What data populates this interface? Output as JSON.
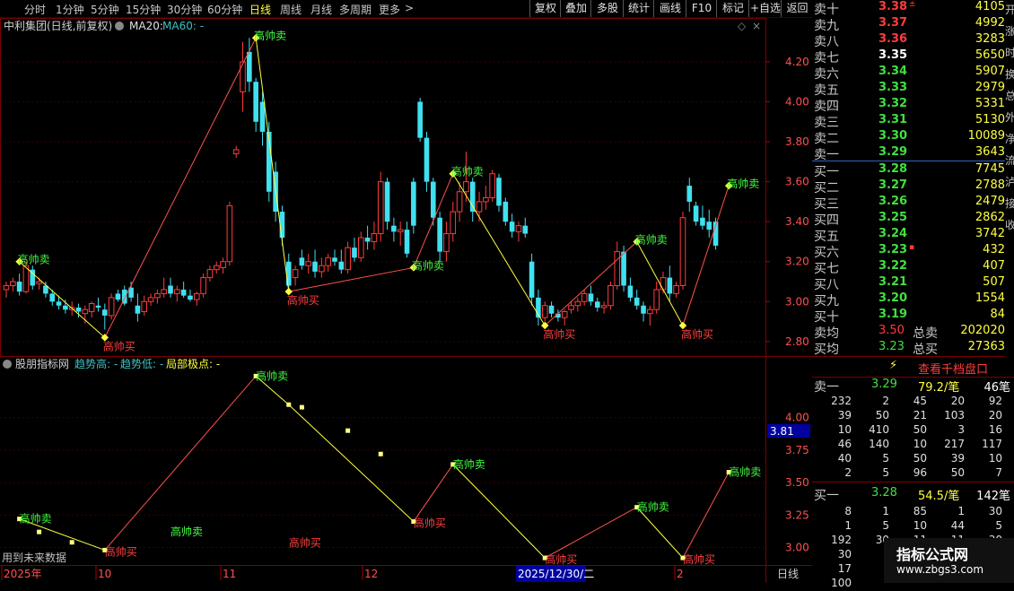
{
  "toolbar": {
    "periods": [
      "分时",
      "1分钟",
      "5分钟",
      "15分钟",
      "30分钟",
      "60分钟",
      "日线",
      "周线",
      "月线",
      "多周期",
      "更多"
    ],
    "active_period": "日线",
    "more_arrow": ">",
    "buttons": [
      "复权",
      "叠加",
      "多股",
      "统计",
      "画线",
      "F10",
      "标记",
      "+自选",
      "返回"
    ]
  },
  "main_panel": {
    "title": "中利集团(日线,前复权)",
    "ma20_label": "MA20:",
    "ma60_label": "MA60: -",
    "y_ticks": [
      "4.20",
      "4.00",
      "3.80",
      "3.60",
      "3.40",
      "3.20",
      "3.00",
      "2.80"
    ]
  },
  "indicator_panel": {
    "title": "股朋指标网",
    "trend_high": "趋势高: -",
    "trend_low": "趋势低: -",
    "local_extreme": "局部极点: -",
    "y_ticks": [
      "4.00",
      "3.75",
      "3.50",
      "3.25",
      "3.00"
    ],
    "current_value": "3.81",
    "future_data_note": "用到未来数据"
  },
  "x_axis": {
    "labels": [
      "2025年",
      "10",
      "11",
      "12",
      "1",
      "2"
    ],
    "cursor_date": "2025/12/30/二",
    "period_label": "日线"
  },
  "signals": {
    "sell": "高帅卖",
    "buy": "高帅买"
  },
  "orderbook": {
    "asks": [
      {
        "label": "卖十",
        "price": "3.38",
        "vol": "4105",
        "color": "#ff3c3c",
        "mark": "±"
      },
      {
        "label": "卖九",
        "price": "3.37",
        "vol": "4992",
        "color": "#ff3c3c",
        "mark": ""
      },
      {
        "label": "卖八",
        "price": "3.36",
        "vol": "3283",
        "color": "#ff3c3c",
        "mark": ""
      },
      {
        "label": "卖七",
        "price": "3.35",
        "vol": "5650",
        "color": "#ffffff",
        "mark": ""
      },
      {
        "label": "卖六",
        "price": "3.34",
        "vol": "5907",
        "color": "#40e040",
        "mark": ""
      },
      {
        "label": "卖五",
        "price": "3.33",
        "vol": "2979",
        "color": "#40e040",
        "mark": ""
      },
      {
        "label": "卖四",
        "price": "3.32",
        "vol": "5331",
        "color": "#40e040",
        "mark": ""
      },
      {
        "label": "卖三",
        "price": "3.31",
        "vol": "5130",
        "color": "#40e040",
        "mark": ""
      },
      {
        "label": "卖二",
        "price": "3.30",
        "vol": "10089",
        "color": "#40e040",
        "mark": ""
      },
      {
        "label": "卖一",
        "price": "3.29",
        "vol": "3643",
        "color": "#40e040",
        "mark": ""
      }
    ],
    "bids": [
      {
        "label": "买一",
        "price": "3.28",
        "vol": "7745",
        "color": "#40e040",
        "mark": ""
      },
      {
        "label": "买二",
        "price": "3.27",
        "vol": "2788",
        "color": "#40e040",
        "mark": ""
      },
      {
        "label": "买三",
        "price": "3.26",
        "vol": "2479",
        "color": "#40e040",
        "mark": ""
      },
      {
        "label": "买四",
        "price": "3.25",
        "vol": "2862",
        "color": "#40e040",
        "mark": ""
      },
      {
        "label": "买五",
        "price": "3.24",
        "vol": "3742",
        "color": "#40e040",
        "mark": ""
      },
      {
        "label": "买六",
        "price": "3.23",
        "vol": "432",
        "color": "#40e040",
        "mark": "▪"
      },
      {
        "label": "买七",
        "price": "3.22",
        "vol": "407",
        "color": "#40e040",
        "mark": ""
      },
      {
        "label": "买八",
        "price": "3.21",
        "vol": "507",
        "color": "#40e040",
        "mark": ""
      },
      {
        "label": "买九",
        "price": "3.20",
        "vol": "1554",
        "color": "#40e040",
        "mark": ""
      },
      {
        "label": "买十",
        "price": "3.19",
        "vol": "84",
        "color": "#40e040",
        "mark": ""
      }
    ],
    "avg_sell": {
      "label": "卖均",
      "price": "3.50",
      "total_label": "总卖",
      "total": "202020"
    },
    "avg_buy": {
      "label": "买均",
      "price": "3.23",
      "total_label": "总买",
      "total": "27363"
    },
    "qiandang_button": "查看千档盘口",
    "sell1_summary": {
      "label": "卖一",
      "price": "3.29",
      "per": "79.2/笔",
      "count": "46笔"
    },
    "sell1_orders": [
      [
        "232",
        "2",
        "45",
        "20",
        "92"
      ],
      [
        "39",
        "50",
        "21",
        "103",
        "20"
      ],
      [
        "10",
        "410",
        "50",
        "3",
        "16"
      ],
      [
        "46",
        "140",
        "10",
        "217",
        "117"
      ],
      [
        "40",
        "5",
        "50",
        "39",
        "10"
      ],
      [
        "2",
        "5",
        "96",
        "50",
        "7"
      ]
    ],
    "buy1_summary": {
      "label": "买一",
      "price": "3.28",
      "per": "54.5/笔",
      "count": "142笔"
    },
    "buy1_orders": [
      [
        "8",
        "1",
        "85",
        "1",
        "30"
      ],
      [
        "1",
        "5",
        "10",
        "44",
        "5"
      ],
      [
        "192",
        "30",
        "11",
        "11",
        "30"
      ],
      [
        "30",
        "",
        "",
        "",
        ""
      ],
      [
        "17",
        "",
        "",
        "",
        ""
      ],
      [
        "100",
        "",
        "",
        "",
        ""
      ]
    ]
  },
  "side_strip": [
    "开",
    "涨",
    "时",
    "换",
    "总",
    "外",
    "净",
    "流",
    "泸",
    "接",
    "收"
  ],
  "watermark": {
    "title": "指标公式网",
    "url": "www.zbgs3.com"
  },
  "chart_data": {
    "type": "candlestick",
    "ylim": [
      2.75,
      4.33
    ],
    "candles": [
      [
        3.06,
        3.1,
        3.02,
        3.08
      ],
      [
        3.08,
        3.12,
        3.05,
        3.1
      ],
      [
        3.1,
        3.14,
        3.03,
        3.05
      ],
      [
        3.05,
        3.2,
        3.04,
        3.18
      ],
      [
        3.16,
        3.18,
        3.06,
        3.08
      ],
      [
        3.09,
        3.12,
        3.06,
        3.1
      ],
      [
        3.08,
        3.1,
        3.02,
        3.04
      ],
      [
        3.04,
        3.06,
        2.98,
        3.0
      ],
      [
        3.0,
        3.03,
        2.96,
        2.98
      ],
      [
        2.98,
        3.01,
        2.94,
        2.96
      ],
      [
        2.96,
        3.0,
        2.93,
        2.97
      ],
      [
        2.97,
        2.99,
        2.92,
        2.95
      ],
      [
        2.94,
        2.98,
        2.89,
        2.96
      ],
      [
        2.95,
        3.0,
        2.92,
        2.99
      ],
      [
        2.98,
        3.02,
        2.95,
        2.97
      ],
      [
        2.96,
        2.99,
        2.86,
        2.93
      ],
      [
        2.93,
        3.04,
        2.91,
        3.02
      ],
      [
        3.04,
        3.06,
        3.0,
        3.01
      ],
      [
        3.06,
        3.08,
        2.98,
        2.99
      ],
      [
        3.07,
        3.1,
        3.0,
        3.02
      ],
      [
        2.98,
        3.04,
        2.9,
        2.94
      ],
      [
        2.95,
        3.03,
        2.93,
        3.0
      ],
      [
        3.0,
        3.04,
        2.98,
        3.02
      ],
      [
        3.02,
        3.06,
        2.99,
        3.04
      ],
      [
        3.04,
        3.12,
        3.02,
        3.06
      ],
      [
        3.08,
        3.12,
        3.02,
        3.04
      ],
      [
        3.04,
        3.08,
        3.0,
        3.06
      ],
      [
        3.06,
        3.1,
        3.02,
        3.03
      ],
      [
        3.03,
        3.06,
        3.0,
        3.01
      ],
      [
        3.01,
        3.05,
        2.98,
        3.04
      ],
      [
        3.04,
        3.14,
        3.02,
        3.12
      ],
      [
        3.12,
        3.18,
        3.1,
        3.16
      ],
      [
        3.16,
        3.2,
        3.14,
        3.18
      ],
      [
        3.17,
        3.22,
        3.14,
        3.2
      ],
      [
        3.2,
        3.5,
        3.18,
        3.48
      ],
      [
        3.74,
        3.78,
        3.72,
        3.76
      ],
      [
        4.05,
        4.3,
        3.95,
        4.2
      ],
      [
        4.25,
        4.32,
        4.05,
        4.1
      ],
      [
        4.1,
        4.12,
        3.85,
        3.9
      ],
      [
        4.0,
        4.05,
        3.78,
        3.85
      ],
      [
        3.85,
        3.9,
        3.5,
        3.55
      ],
      [
        3.65,
        3.7,
        3.4,
        3.45
      ],
      [
        3.45,
        3.48,
        3.28,
        3.32
      ],
      [
        3.2,
        3.24,
        3.05,
        3.08
      ],
      [
        3.12,
        3.18,
        3.08,
        3.16
      ],
      [
        3.22,
        3.26,
        3.16,
        3.18
      ],
      [
        3.18,
        3.24,
        3.14,
        3.2
      ],
      [
        3.2,
        3.26,
        3.12,
        3.15
      ],
      [
        3.15,
        3.22,
        3.12,
        3.18
      ],
      [
        3.18,
        3.24,
        3.15,
        3.22
      ],
      [
        3.22,
        3.26,
        3.18,
        3.2
      ],
      [
        3.2,
        3.26,
        3.14,
        3.16
      ],
      [
        3.16,
        3.3,
        3.14,
        3.27
      ],
      [
        3.27,
        3.32,
        3.2,
        3.22
      ],
      [
        3.22,
        3.35,
        3.2,
        3.32
      ],
      [
        3.32,
        3.38,
        3.26,
        3.3
      ],
      [
        3.3,
        3.4,
        3.26,
        3.34
      ],
      [
        3.34,
        3.65,
        3.3,
        3.6
      ],
      [
        3.6,
        3.62,
        3.36,
        3.4
      ],
      [
        3.38,
        3.42,
        3.3,
        3.35
      ],
      [
        3.35,
        3.4,
        3.28,
        3.36
      ],
      [
        3.36,
        3.4,
        3.22,
        3.24
      ],
      [
        3.6,
        3.62,
        3.34,
        3.38
      ],
      [
        4.0,
        4.02,
        3.8,
        3.82
      ],
      [
        3.82,
        3.85,
        3.55,
        3.6
      ],
      [
        3.6,
        3.62,
        3.38,
        3.42
      ],
      [
        3.42,
        3.45,
        3.2,
        3.25
      ],
      [
        3.25,
        3.4,
        3.2,
        3.34
      ],
      [
        3.34,
        3.5,
        3.3,
        3.45
      ],
      [
        3.45,
        3.6,
        3.4,
        3.55
      ],
      [
        3.55,
        3.75,
        3.5,
        3.6
      ],
      [
        3.6,
        3.62,
        3.4,
        3.45
      ],
      [
        3.45,
        3.55,
        3.4,
        3.5
      ],
      [
        3.5,
        3.58,
        3.46,
        3.52
      ],
      [
        3.52,
        3.66,
        3.5,
        3.64
      ],
      [
        3.62,
        3.64,
        3.45,
        3.48
      ],
      [
        3.5,
        3.52,
        3.38,
        3.4
      ],
      [
        3.4,
        3.44,
        3.32,
        3.35
      ],
      [
        3.35,
        3.4,
        3.3,
        3.38
      ],
      [
        3.38,
        3.42,
        3.32,
        3.34
      ],
      [
        3.2,
        3.24,
        2.98,
        3.02
      ],
      [
        3.02,
        3.06,
        2.88,
        2.92
      ],
      [
        2.92,
        3.0,
        2.9,
        2.98
      ],
      [
        2.98,
        3.0,
        2.92,
        2.94
      ],
      [
        2.94,
        2.96,
        2.9,
        2.92
      ],
      [
        2.92,
        2.96,
        2.88,
        2.95
      ],
      [
        2.96,
        3.0,
        2.94,
        2.98
      ],
      [
        2.98,
        3.02,
        2.95,
        3.0
      ],
      [
        3.0,
        3.06,
        2.98,
        3.04
      ],
      [
        3.04,
        3.08,
        2.98,
        3.0
      ],
      [
        3.0,
        3.02,
        2.95,
        2.97
      ],
      [
        2.97,
        3.0,
        2.94,
        2.98
      ],
      [
        2.98,
        3.1,
        2.96,
        3.08
      ],
      [
        3.08,
        3.3,
        3.06,
        3.25
      ],
      [
        3.25,
        3.28,
        3.05,
        3.08
      ],
      [
        3.08,
        3.12,
        3.0,
        3.02
      ],
      [
        3.02,
        3.06,
        2.96,
        2.98
      ],
      [
        2.98,
        3.0,
        2.9,
        2.94
      ],
      [
        2.94,
        2.98,
        2.88,
        2.96
      ],
      [
        2.96,
        3.1,
        2.94,
        3.06
      ],
      [
        3.06,
        3.15,
        3.04,
        3.12
      ],
      [
        3.12,
        3.18,
        3.0,
        3.04
      ],
      [
        3.04,
        3.1,
        3.02,
        3.08
      ],
      [
        3.08,
        3.45,
        3.06,
        3.42
      ],
      [
        3.58,
        3.62,
        3.45,
        3.5
      ],
      [
        3.48,
        3.5,
        3.38,
        3.4
      ],
      [
        3.42,
        3.48,
        3.36,
        3.38
      ],
      [
        3.4,
        3.46,
        3.32,
        3.36
      ],
      [
        3.4,
        3.42,
        3.26,
        3.28
      ]
    ],
    "zigzag": [
      [
        2,
        3.2
      ],
      [
        15,
        2.82
      ],
      [
        38,
        4.32
      ],
      [
        43,
        3.05
      ],
      [
        62,
        3.17
      ],
      [
        68,
        3.64
      ],
      [
        82,
        2.88
      ],
      [
        96,
        3.3
      ],
      [
        103,
        2.88
      ],
      [
        110,
        3.58
      ]
    ],
    "indicator_zigzag": [
      [
        2,
        3.22
      ],
      [
        15,
        2.98
      ],
      [
        38,
        4.32
      ],
      [
        43,
        4.1
      ],
      [
        62,
        3.2
      ],
      [
        68,
        3.64
      ],
      [
        82,
        2.92
      ],
      [
        96,
        3.31
      ],
      [
        103,
        2.92
      ],
      [
        110,
        3.58
      ]
    ],
    "indicator_extra_points": [
      [
        5,
        3.12
      ],
      [
        10,
        3.04
      ],
      [
        45,
        4.08
      ],
      [
        52,
        3.9
      ],
      [
        57,
        3.72
      ]
    ],
    "indicator_sell_labels": [
      [
        2,
        3.22
      ],
      [
        25,
        3.12
      ],
      [
        38,
        4.32
      ],
      [
        68,
        3.64
      ],
      [
        96,
        3.31
      ],
      [
        110,
        3.58
      ]
    ],
    "indicator_buy_labels": [
      [
        15,
        2.98
      ],
      [
        43,
        3.05
      ],
      [
        62,
        3.2
      ],
      [
        82,
        2.92
      ],
      [
        103,
        2.92
      ]
    ]
  }
}
